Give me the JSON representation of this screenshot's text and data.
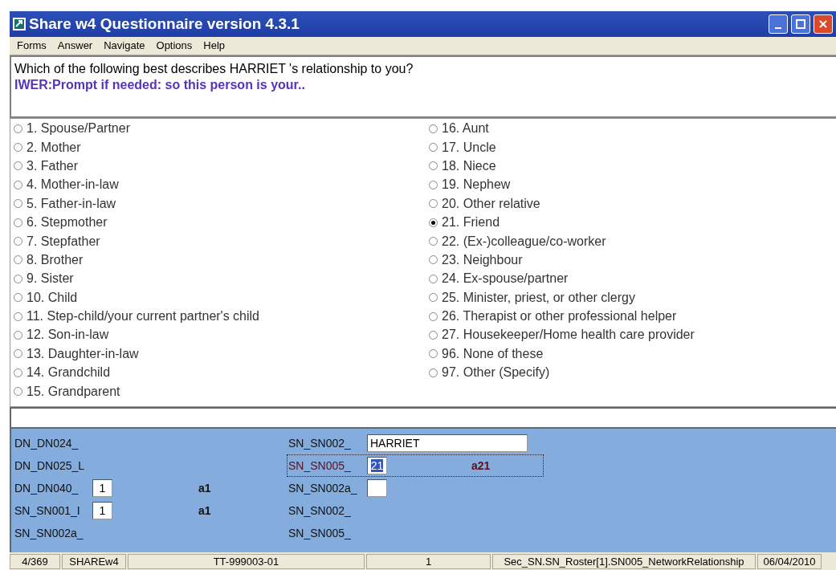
{
  "window": {
    "title": "Share w4 Questionnaire version 4.3.1"
  },
  "menu": [
    "Forms",
    "Answer",
    "Navigate",
    "Options",
    "Help"
  ],
  "question": {
    "text": "Which of the following best describes HARRIET 's relationship to you?",
    "instruction": "IWER:Prompt if needed: so this person is your.."
  },
  "answer_columns": [
    [
      {
        "label": "1. Spouse/Partner",
        "selected": false
      },
      {
        "label": "2. Mother",
        "selected": false
      },
      {
        "label": "3. Father",
        "selected": false
      },
      {
        "label": "4. Mother-in-law",
        "selected": false
      },
      {
        "label": "5. Father-in-law",
        "selected": false
      },
      {
        "label": "6. Stepmother",
        "selected": false
      },
      {
        "label": "7. Stepfather",
        "selected": false
      },
      {
        "label": "8. Brother",
        "selected": false
      },
      {
        "label": "9. Sister",
        "selected": false
      },
      {
        "label": "10. Child",
        "selected": false
      },
      {
        "label": "11. Step-child/your current partner's child",
        "selected": false
      },
      {
        "label": "12. Son-in-law",
        "selected": false
      },
      {
        "label": "13. Daughter-in-law",
        "selected": false
      },
      {
        "label": "14. Grandchild",
        "selected": false
      },
      {
        "label": "15. Grandparent",
        "selected": false
      }
    ],
    [
      {
        "label": "16. Aunt",
        "selected": false
      },
      {
        "label": "17. Uncle",
        "selected": false
      },
      {
        "label": "18. Niece",
        "selected": false
      },
      {
        "label": "19. Nephew",
        "selected": false
      },
      {
        "label": "20. Other relative",
        "selected": false
      },
      {
        "label": "21. Friend",
        "selected": true
      },
      {
        "label": "22. (Ex-)colleague/co-worker",
        "selected": false
      },
      {
        "label": "23. Neighbour",
        "selected": false
      },
      {
        "label": "24. Ex-spouse/partner",
        "selected": false
      },
      {
        "label": "25. Minister, priest, or other clergy",
        "selected": false
      },
      {
        "label": "26. Therapist or other professional helper",
        "selected": false
      },
      {
        "label": "27. Housekeeper/Home health care provider",
        "selected": false
      },
      {
        "label": "96. None of these",
        "selected": false
      },
      {
        "label": "97. Other (Specify)",
        "selected": false
      }
    ]
  ],
  "field_columns": [
    [
      {
        "label": "DN_DN024_",
        "focused": false
      },
      {
        "label": "DN_DN025_L",
        "focused": false
      },
      {
        "label": "DN_DN040_",
        "value": "1",
        "code": "a1",
        "focused": false
      },
      {
        "label": "SN_SN001_I",
        "value": "1",
        "code": "a1",
        "focused": false
      },
      {
        "label": "SN_SN002a_",
        "focused": false
      }
    ],
    [
      {
        "label": "SN_SN002_",
        "value": "HARRIET",
        "kind": "text",
        "focused": false
      },
      {
        "label": "SN_SN005_",
        "value": "21",
        "code": "a21",
        "kind": "code",
        "focused": true
      },
      {
        "label": "SN_SN002a_",
        "kind": "code",
        "focused": false
      },
      {
        "label": "SN_SN002_",
        "focused": false
      },
      {
        "label": "SN_SN005_",
        "focused": false
      }
    ]
  ],
  "status_bar": [
    "4/369",
    "SHAREw4",
    "TT-999003-01",
    "1",
    "Sec_SN.SN_Roster[1].SN005_NetworkRelationship",
    "06/04/2010"
  ]
}
